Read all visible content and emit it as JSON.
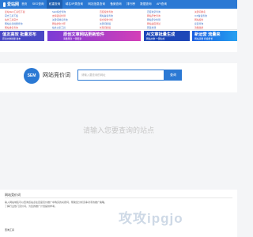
{
  "brand": {
    "logo_text": "爱站网",
    "color": "#2b79d4"
  },
  "nav": {
    "items": [
      "首页",
      "SEO查询",
      "权重查询",
      "域名/IP类查询",
      "网站信息查询",
      "备案查询",
      "排行榜",
      "数据查询",
      "API查询",
      "API商城"
    ],
    "active_index": 2
  },
  "links": {
    "col1": [
      "爱站SEO工具包下载",
      "官方工具下载",
      "站长工具官方",
      "网站信息批量查询",
      "网站排名查询"
    ],
    "col2": [
      "SEO综合查询",
      "友情链接检测",
      "关键词排名查询",
      "网站优化大师",
      "站长之家工具"
    ],
    "col3": [
      "百度权重查询",
      "网站备案查询",
      "综合权重分析",
      "关键词挖掘",
      "长尾词挖掘"
    ],
    "col4": [
      "百度收录查询",
      "网站历史查询",
      "网站安全检测",
      "网站速度测试",
      "死链检测"
    ],
    "col5": [
      "关键词排名",
      "ICP备案查询",
      "网站权重",
      "反链查询",
      "流量趋势"
    ]
  },
  "banners": [
    {
      "title": "值友高效 批量发布",
      "subtitle": "原创文章批量 发布",
      "color": "#4a48c5"
    },
    {
      "title": "原创文章网站更新软件",
      "subtitle": "海量原创 一键更新",
      "color": "#c73cc2"
    },
    {
      "title": "AI文章批量生成",
      "subtitle": "网站文章 一键生成",
      "color": "#1e47b8"
    },
    {
      "title": "新运营 流量来",
      "subtitle": "网站流量 持续增长",
      "color": "#1a5ce0"
    }
  ],
  "search": {
    "title": "网站竞价词",
    "placeholder": "请输入要查询的网址",
    "button_label": "查询"
  },
  "main": {
    "empty_text": "请输入您要查询的站点"
  },
  "info": {
    "title": "网站竞价词",
    "lines": [
      "输入网站域名可以查询该站点在百度竞价推广中购买的关键词，帮助您分析竞争对手的推广策略，",
      "了解行业热门竞价词，为您的推广计划提供参考。",
      "查询工具"
    ]
  },
  "watermark": {
    "text": "攻攻ipgjo"
  }
}
